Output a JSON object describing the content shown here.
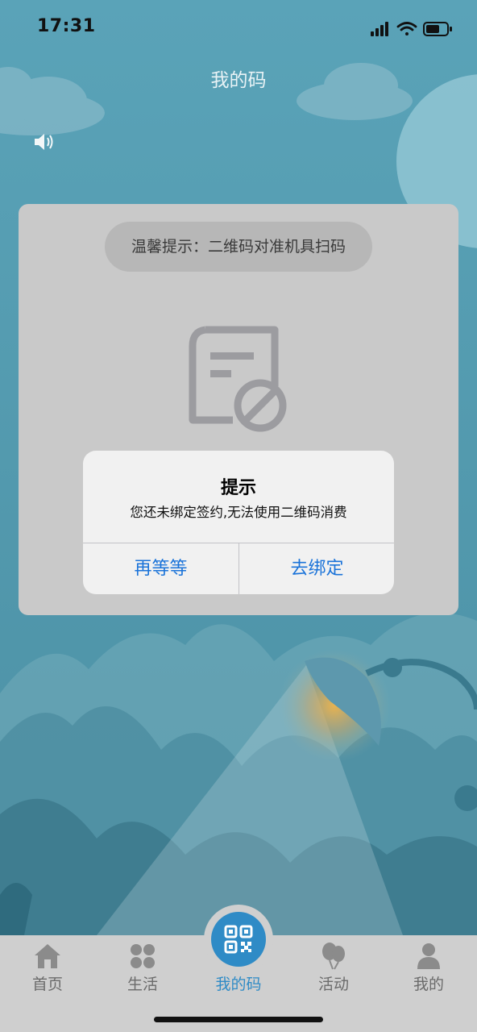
{
  "status_bar": {
    "time": "17:31"
  },
  "page": {
    "title": "我的码"
  },
  "panel": {
    "tip": "温馨提示：二维码对准机具扫码"
  },
  "alert": {
    "title": "提示",
    "message": "您还未绑定签约,无法使用二维码消费",
    "cancel_label": "再等等",
    "confirm_label": "去绑定"
  },
  "tab_bar": {
    "items": [
      {
        "label": "首页",
        "icon": "home-icon"
      },
      {
        "label": "生活",
        "icon": "clover-icon"
      },
      {
        "label": "我的码",
        "icon": "qr-code-icon"
      },
      {
        "label": "活动",
        "icon": "balloon-icon"
      },
      {
        "label": "我的",
        "icon": "person-icon"
      }
    ],
    "active_index": 2
  },
  "colors": {
    "sky": "#4f94a8",
    "accent": "#2f8bc6",
    "alert_button": "#1a73d9",
    "panel": "#c9c9c9"
  }
}
